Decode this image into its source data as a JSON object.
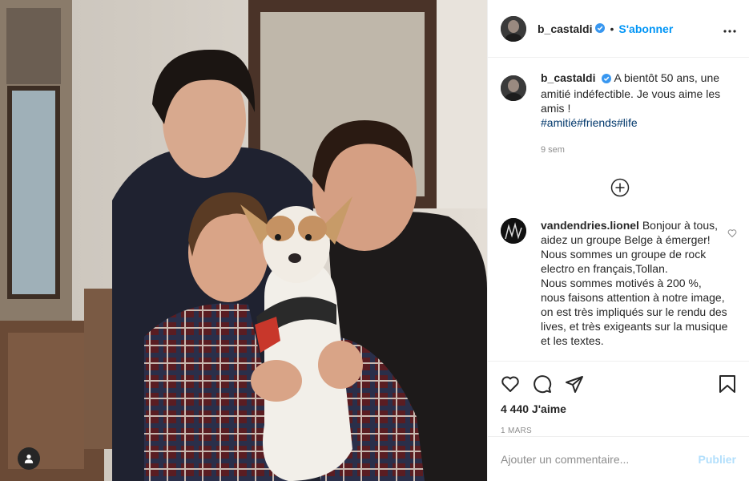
{
  "post": {
    "author": "b_castaldi",
    "verified": true,
    "follow_label": "S'abonner",
    "separator": "•",
    "more_icon": "more-horizontal-icon",
    "caption_text": " A bientôt 50 ans, une amitié indéfectible. Je vous aime les amis !",
    "hashtags": [
      "#amitié",
      "#friends",
      "#life"
    ],
    "caption_time": "9 sem",
    "load_more_icon": "plus-circle-icon",
    "comments": [
      {
        "user": "vandendries.lionel",
        "text_part1": " Bonjour à tous, aidez un groupe Belge à émerger! Nous sommes un groupe de rock electro en français,Tollan.",
        "text_part2": "Nous sommes motivés à 200 %, nous faisons attention à notre image, on est très impliqués sur le rendu des lives, et très exigeants sur la musique et les textes.",
        "like_icon": "heart-outline-icon"
      }
    ],
    "actions": {
      "like_icon": "heart-outline-icon",
      "comment_icon": "speech-bubble-icon",
      "share_icon": "paper-plane-icon",
      "save_icon": "bookmark-icon"
    },
    "likes": "4 440 J'aime",
    "date": "1 mars",
    "add_comment_placeholder": "Ajouter un commentaire...",
    "publish_label": "Publier",
    "tag_icon": "user-tag-icon"
  },
  "colors": {
    "accent": "#0095f6",
    "publish_disabled": "#b2dffc",
    "hashtag": "#00376b",
    "muted": "#8e8e8e"
  }
}
